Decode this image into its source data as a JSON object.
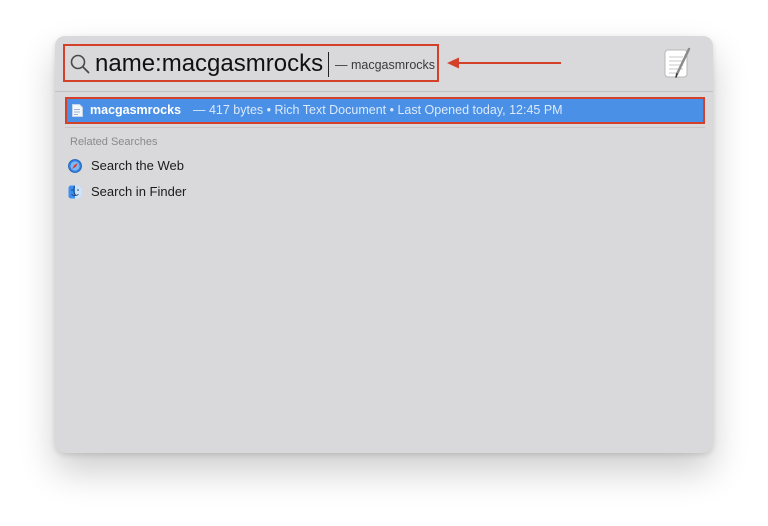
{
  "search": {
    "query": "name:macgasmrocks",
    "completion": "— macgasmrocks"
  },
  "top_hit": {
    "name": "macgasmrocks",
    "details": "— 417 bytes • Rich Text Document • Last Opened today, 12:45 PM",
    "icon": "rich-text-document-icon"
  },
  "related_searches": {
    "label": "Related Searches",
    "items": [
      {
        "label": "Search the Web",
        "icon": "safari-icon"
      },
      {
        "label": "Search in Finder",
        "icon": "finder-icon"
      }
    ]
  },
  "preview": {
    "icon": "textedit-icon"
  },
  "colors": {
    "annotation": "#d5402a",
    "selection": "#4a90e6",
    "panel": "#d9d8da"
  }
}
